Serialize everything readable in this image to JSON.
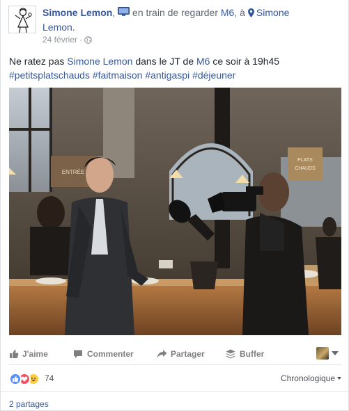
{
  "post": {
    "author": "Simone Lemon",
    "comma": ",",
    "activity": "en train de regarder",
    "activity_target": "M6",
    "at_word": ", à",
    "location_line1": "Simone",
    "location_line2": "Lemon.",
    "date": "24 février",
    "date_sep": "·",
    "privacy_icon": "globe-icon",
    "text": {
      "part1": "Ne ratez pas ",
      "mention": "Simone Lemon",
      "part2": " dans le JT de ",
      "channel": "M6",
      "part3": " ce soir à 19h45",
      "hashtags": [
        "#petitsplatschauds",
        "#faitmaison",
        "#antigaspi",
        "#déjeuner"
      ]
    },
    "photo_signs": {
      "left": "ENTRÉE",
      "right_top": "PLATS",
      "right_bottom": "CHAUDS"
    }
  },
  "actions": {
    "like": "J'aime",
    "comment": "Commenter",
    "share": "Partager",
    "buffer": "Buffer"
  },
  "reactions": {
    "count": "74",
    "types": [
      "like",
      "love",
      "haha"
    ],
    "sort_label": "Chronologique"
  },
  "shares": "2 partages",
  "colors": {
    "link": "#365899",
    "like": "#5890ff",
    "love": "#f25268",
    "haha": "#fccd45",
    "muted": "#90949c"
  }
}
